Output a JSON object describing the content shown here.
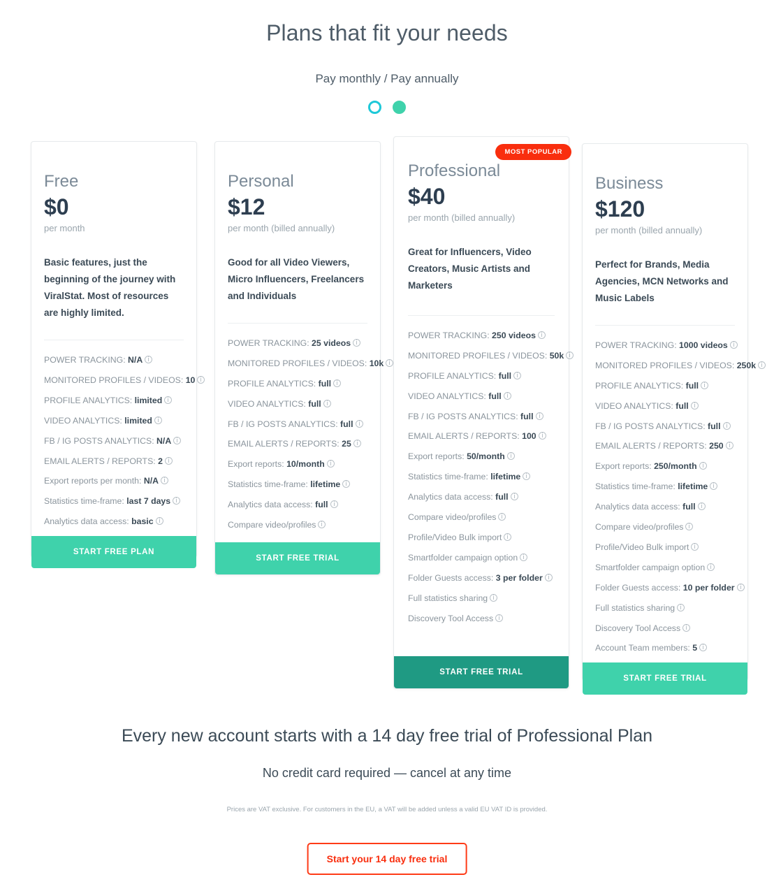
{
  "header": {
    "title": "Plans that fit your needs",
    "billing_label": "Pay monthly / Pay annually",
    "toggle": {
      "monthly_name": "pay-monthly",
      "annually_name": "pay-annually",
      "selected": "annually",
      "off_color": "#1ec8d8",
      "on_color": "#3fd2ab"
    }
  },
  "plans": [
    {
      "name": "Free",
      "price": "$0",
      "period": "per month",
      "description": "Basic features, just the beginning of the journey with ViralStat. Most of resources are highly limited.",
      "cta": "START FREE PLAN",
      "cta_style": "light",
      "badge": null,
      "features": [
        {
          "label": "POWER TRACKING:",
          "value": "N/A"
        },
        {
          "label": "MONITORED PROFILES / VIDEOS:",
          "value": "10"
        },
        {
          "label": "PROFILE ANALYTICS:",
          "value": "limited"
        },
        {
          "label": "VIDEO ANALYTICS:",
          "value": "limited"
        },
        {
          "label": "FB / IG POSTS ANALYTICS:",
          "value": "N/A"
        },
        {
          "label": "EMAIL ALERTS / REPORTS:",
          "value": "2"
        },
        {
          "label": "Export reports per month:",
          "value": "N/A"
        },
        {
          "label": "Statistics time-frame:",
          "value": "last 7 days"
        },
        {
          "label": "Analytics data access:",
          "value": "basic"
        }
      ]
    },
    {
      "name": "Personal",
      "price": "$12",
      "period": "per month (billed annually)",
      "description": "Good for all Video Viewers, Micro Influencers, Freelancers and Individuals",
      "cta": "START FREE TRIAL",
      "cta_style": "light",
      "badge": null,
      "features": [
        {
          "label": "POWER TRACKING:",
          "value": "25 videos"
        },
        {
          "label": "MONITORED PROFILES / VIDEOS:",
          "value": "10k"
        },
        {
          "label": "PROFILE ANALYTICS:",
          "value": "full"
        },
        {
          "label": "VIDEO ANALYTICS:",
          "value": "full"
        },
        {
          "label": "FB / IG POSTS ANALYTICS:",
          "value": "full"
        },
        {
          "label": "EMAIL ALERTS / REPORTS:",
          "value": "25"
        },
        {
          "label": "Export reports:",
          "value": "10/month"
        },
        {
          "label": "Statistics time-frame:",
          "value": "lifetime"
        },
        {
          "label": "Analytics data access:",
          "value": "full"
        },
        {
          "label": "Compare video/profiles",
          "value": ""
        }
      ]
    },
    {
      "name": "Professional",
      "price": "$40",
      "period": "per month (billed annually)",
      "description": "Great for Influencers, Video Creators, Music Artists and Marketers",
      "cta": "START FREE TRIAL",
      "cta_style": "dark",
      "badge": "MOST POPULAR",
      "features": [
        {
          "label": "POWER TRACKING:",
          "value": "250 videos"
        },
        {
          "label": "MONITORED PROFILES / VIDEOS:",
          "value": "50k"
        },
        {
          "label": "PROFILE ANALYTICS:",
          "value": "full"
        },
        {
          "label": "VIDEO ANALYTICS:",
          "value": "full"
        },
        {
          "label": "FB / IG POSTS ANALYTICS:",
          "value": "full"
        },
        {
          "label": "EMAIL ALERTS / REPORTS:",
          "value": "100"
        },
        {
          "label": "Export reports:",
          "value": "50/month"
        },
        {
          "label": "Statistics time-frame:",
          "value": "lifetime"
        },
        {
          "label": "Analytics data access:",
          "value": "full"
        },
        {
          "label": "Compare video/profiles",
          "value": ""
        },
        {
          "label": "Profile/Video Bulk import",
          "value": ""
        },
        {
          "label": "Smartfolder campaign option",
          "value": ""
        },
        {
          "label": "Folder Guests access:",
          "value": "3 per folder"
        },
        {
          "label": "Full statistics sharing",
          "value": ""
        },
        {
          "label": "Discovery Tool Access",
          "value": ""
        }
      ]
    },
    {
      "name": "Business",
      "price": "$120",
      "period": "per month (billed annually)",
      "description": "Perfect for Brands, Media Agencies, MCN Networks and Music Labels",
      "cta": "START FREE TRIAL",
      "cta_style": "light",
      "badge": null,
      "features": [
        {
          "label": "POWER TRACKING:",
          "value": "1000 videos"
        },
        {
          "label": "MONITORED PROFILES / VIDEOS:",
          "value": "250k"
        },
        {
          "label": "PROFILE ANALYTICS:",
          "value": "full"
        },
        {
          "label": "VIDEO ANALYTICS:",
          "value": "full"
        },
        {
          "label": "FB / IG POSTS ANALYTICS:",
          "value": "full"
        },
        {
          "label": "EMAIL ALERTS / REPORTS:",
          "value": "250"
        },
        {
          "label": "Export reports:",
          "value": "250/month"
        },
        {
          "label": "Statistics time-frame:",
          "value": "lifetime"
        },
        {
          "label": "Analytics data access:",
          "value": "full"
        },
        {
          "label": "Compare video/profiles",
          "value": ""
        },
        {
          "label": "Profile/Video Bulk import",
          "value": ""
        },
        {
          "label": "Smartfolder campaign option",
          "value": ""
        },
        {
          "label": "Folder Guests access:",
          "value": "10 per folder"
        },
        {
          "label": "Full statistics sharing",
          "value": ""
        },
        {
          "label": "Discovery Tool Access",
          "value": ""
        },
        {
          "label": "Account Team members:",
          "value": "5"
        }
      ]
    }
  ],
  "footer": {
    "headline": "Every new account starts with a 14 day free trial of Professional Plan",
    "subline": "No credit card required — cancel at any time",
    "vat_note": "Prices are VAT exclusive. For customers in the EU, a VAT will be added unless a valid EU VAT ID is provided.",
    "cta": "Start your 14 day free trial",
    "cta_color": "#f92e0e"
  }
}
